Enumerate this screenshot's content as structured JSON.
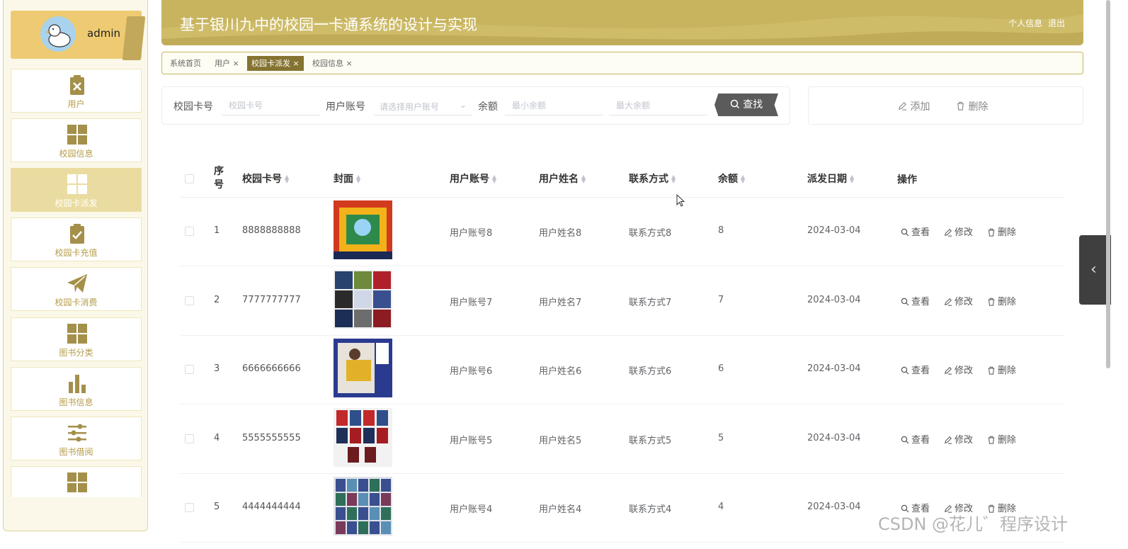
{
  "user": {
    "name": "admin"
  },
  "sidebar": {
    "items": [
      {
        "label": "用户",
        "icon": "clipboard-x-icon"
      },
      {
        "label": "校园信息",
        "icon": "grid-icon"
      },
      {
        "label": "校园卡派发",
        "icon": "grid-icon",
        "active": true
      },
      {
        "label": "校园卡充值",
        "icon": "clipboard-check-icon"
      },
      {
        "label": "校园卡消费",
        "icon": "paper-plane-icon"
      },
      {
        "label": "图书分类",
        "icon": "grid-icon"
      },
      {
        "label": "图书信息",
        "icon": "bar-chart-icon"
      },
      {
        "label": "图书借阅",
        "icon": "sliders-icon"
      },
      {
        "label": "",
        "icon": "grid-icon"
      }
    ]
  },
  "header": {
    "title": "基于银川九中的校园一卡通系统的设计与实现",
    "profile_label": "个人信息",
    "logout_label": "退出"
  },
  "tabs": [
    {
      "label": "系统首页"
    },
    {
      "label": "用户 ×"
    },
    {
      "label": "校园卡派发 ×",
      "active": true
    },
    {
      "label": "校园信息 ×"
    }
  ],
  "search": {
    "card_label": "校园卡号",
    "card_placeholder": "校园卡号",
    "account_label": "用户账号",
    "account_placeholder": "请选择用户账号",
    "balance_label": "余额",
    "min_placeholder": "最小余额",
    "max_placeholder": "最大余额",
    "search_button": "查找"
  },
  "actions": {
    "add_label": "添加",
    "delete_label": "删除"
  },
  "table": {
    "columns": {
      "index": "序号",
      "card_no": "校园卡号",
      "cover": "封面",
      "account": "用户账号",
      "name": "用户姓名",
      "contact": "联系方式",
      "balance": "余额",
      "date": "派发日期",
      "ops": "操作"
    },
    "row_ops": {
      "view": "查看",
      "edit": "修改",
      "delete": "删除"
    },
    "rows": [
      {
        "index": "1",
        "card_no": "8888888888",
        "account": "用户账号8",
        "name": "用户姓名8",
        "contact": "联系方式8",
        "balance": "8",
        "date": "2024-03-04"
      },
      {
        "index": "2",
        "card_no": "7777777777",
        "account": "用户账号7",
        "name": "用户姓名7",
        "contact": "联系方式7",
        "balance": "7",
        "date": "2024-03-04"
      },
      {
        "index": "3",
        "card_no": "6666666666",
        "account": "用户账号6",
        "name": "用户姓名6",
        "contact": "联系方式6",
        "balance": "6",
        "date": "2024-03-04"
      },
      {
        "index": "4",
        "card_no": "5555555555",
        "account": "用户账号5",
        "name": "用户姓名5",
        "contact": "联系方式5",
        "balance": "5",
        "date": "2024-03-04"
      },
      {
        "index": "5",
        "card_no": "4444444444",
        "account": "用户账号4",
        "name": "用户姓名4",
        "contact": "联系方式4",
        "balance": "4",
        "date": "2024-03-04"
      }
    ]
  },
  "watermark": "CSDN @花儿゛程序设计",
  "colors": {
    "accent": "#c8b45e",
    "active_tab": "#857331",
    "sidebar_active": "#eadca0",
    "label_gold": "#b59c48"
  }
}
